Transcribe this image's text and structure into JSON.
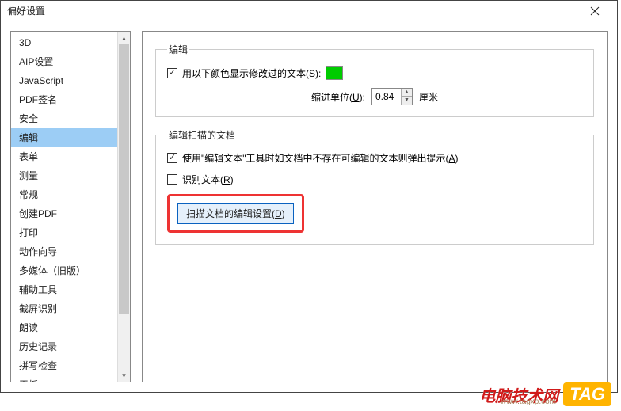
{
  "window": {
    "title": "偏好设置"
  },
  "sidebar": {
    "items": [
      {
        "label": "3D"
      },
      {
        "label": "AIP设置"
      },
      {
        "label": "JavaScript"
      },
      {
        "label": "PDF签名"
      },
      {
        "label": "安全"
      },
      {
        "label": "编辑",
        "selected": true
      },
      {
        "label": "表单"
      },
      {
        "label": "测量"
      },
      {
        "label": "常规"
      },
      {
        "label": "创建PDF"
      },
      {
        "label": "打印"
      },
      {
        "label": "动作向导"
      },
      {
        "label": "多媒体（旧版）"
      },
      {
        "label": "辅助工具"
      },
      {
        "label": "截屏识别"
      },
      {
        "label": "朗读"
      },
      {
        "label": "历史记录"
      },
      {
        "label": "拼写检查"
      },
      {
        "label": "平板"
      }
    ]
  },
  "editSection": {
    "legend": "编辑",
    "showModifiedLabel": "用以下颜色显示修改过的文本(",
    "showModifiedKey": "S",
    "showModifiedSuffix": "):",
    "color": "#00cc00",
    "indentLabel": "缩进单位(",
    "indentKey": "U",
    "indentSuffix": "):",
    "indentValue": "0.84",
    "indentUnit": "厘米"
  },
  "scanSection": {
    "legend": "编辑扫描的文档",
    "promptLabel": "使用\"编辑文本\"工具时如文档中不存在可编辑的文本则弹出提示(",
    "promptKey": "A",
    "promptSuffix": ")",
    "recognizeLabel": "识别文本(",
    "recognizeKey": "R",
    "recognizeSuffix": ")",
    "scanBtnLabel": "扫描文档的编辑设置(",
    "scanBtnKey": "D",
    "scanBtnSuffix": ")"
  },
  "watermark": {
    "text": "电脑技术网",
    "url": "www.tagxp.com",
    "tag": "TAG"
  }
}
